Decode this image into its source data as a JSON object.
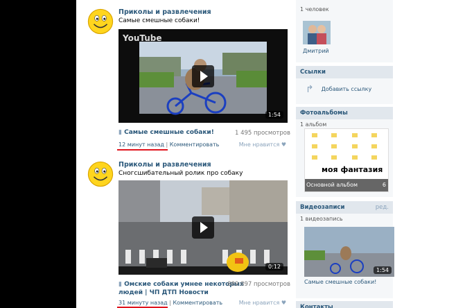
{
  "sidebar_top": {
    "people_count": "1 человек",
    "person_name": "Дмитрий"
  },
  "links": {
    "header": "Ссылки",
    "add_link": "Добавить ссылку"
  },
  "photo_albums": {
    "header": "Фотоальбомы",
    "count": "1 альбом",
    "album_title": "моя фантазия",
    "album_overlay_text": "Основной альбом",
    "album_photo_count": "6"
  },
  "videos_block": {
    "header": "Видеозаписи",
    "edit": "ред.",
    "count": "1 видеозапись",
    "duration": "1:54",
    "title": "Самые смешные собаки!"
  },
  "contacts_header": "Контакты",
  "posts": [
    {
      "author": "Приколы и развлечения",
      "text": "Самые смешные собаки!",
      "video_title": "Самые смешные собаки!",
      "views": "1 495 просмотров",
      "time": "12 минут назад",
      "comment": "Комментировать",
      "like": "Мне нравится",
      "duration": "1:54",
      "source_logo": "YouTube"
    },
    {
      "author": "Приколы и развлечения",
      "text": "Сногсшибательный ролик про собаку",
      "video_title_line1": "Омские собаки умнее некоторых",
      "video_title_line2": "людей | ЧП ДТП Новости",
      "views": "889 897 просмотров",
      "time": "31 минуту назад",
      "comment": "Комментировать",
      "like": "Мне нравится",
      "duration": "0:12"
    }
  ],
  "colors": {
    "link": "#2b587a",
    "header_bg": "#e1e7ed",
    "underline": "#e0141e"
  }
}
